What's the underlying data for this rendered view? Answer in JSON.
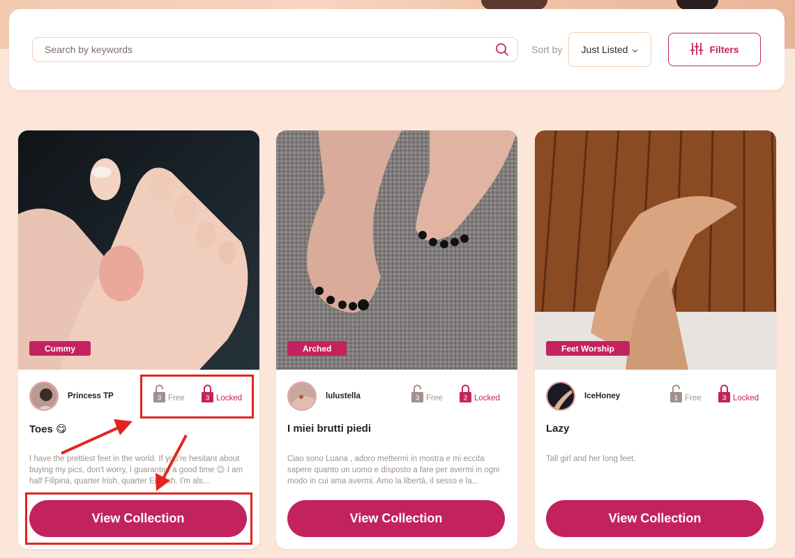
{
  "search": {
    "placeholder": "Search by keywords",
    "sort_label": "Sort by",
    "sort_value": "Just Listed",
    "filters_label": "Filters"
  },
  "colors": {
    "accent": "#c2235f",
    "annotation": "#e3241c",
    "muted": "#a0918d"
  },
  "cards": [
    {
      "tag": "Cummy",
      "username": "Princess TP",
      "free_count": "3",
      "free_label": "Free",
      "locked_count": "3",
      "locked_label": "Locked",
      "title": "Toes 😋",
      "description": "I have the prettiest feet in the world. If you're hesitant about buying my pics, don't worry, I guarantee a good time 😉 I am half Filipina, quarter Irish, quarter English. I'm als...",
      "button": "View Collection"
    },
    {
      "tag": "Arched",
      "username": "lulustella",
      "free_count": "3",
      "free_label": "Free",
      "locked_count": "2",
      "locked_label": "Locked",
      "title": "I miei brutti piedi",
      "description": "Ciao sono Luana , adoro mettermi in mostra e mi eccita sapere quanto un uomo e disposto a fare per avermi in ogni modo in cui ama avermi. Amo la libertà, il sesso e la...",
      "button": "View Collection"
    },
    {
      "tag": "Feet Worship",
      "username": "IceHoney",
      "free_count": "1",
      "free_label": "Free",
      "locked_count": "3",
      "locked_label": "Locked",
      "title": "Lazy",
      "description": "Tall girl and her long feet.",
      "button": "View Collection"
    }
  ]
}
